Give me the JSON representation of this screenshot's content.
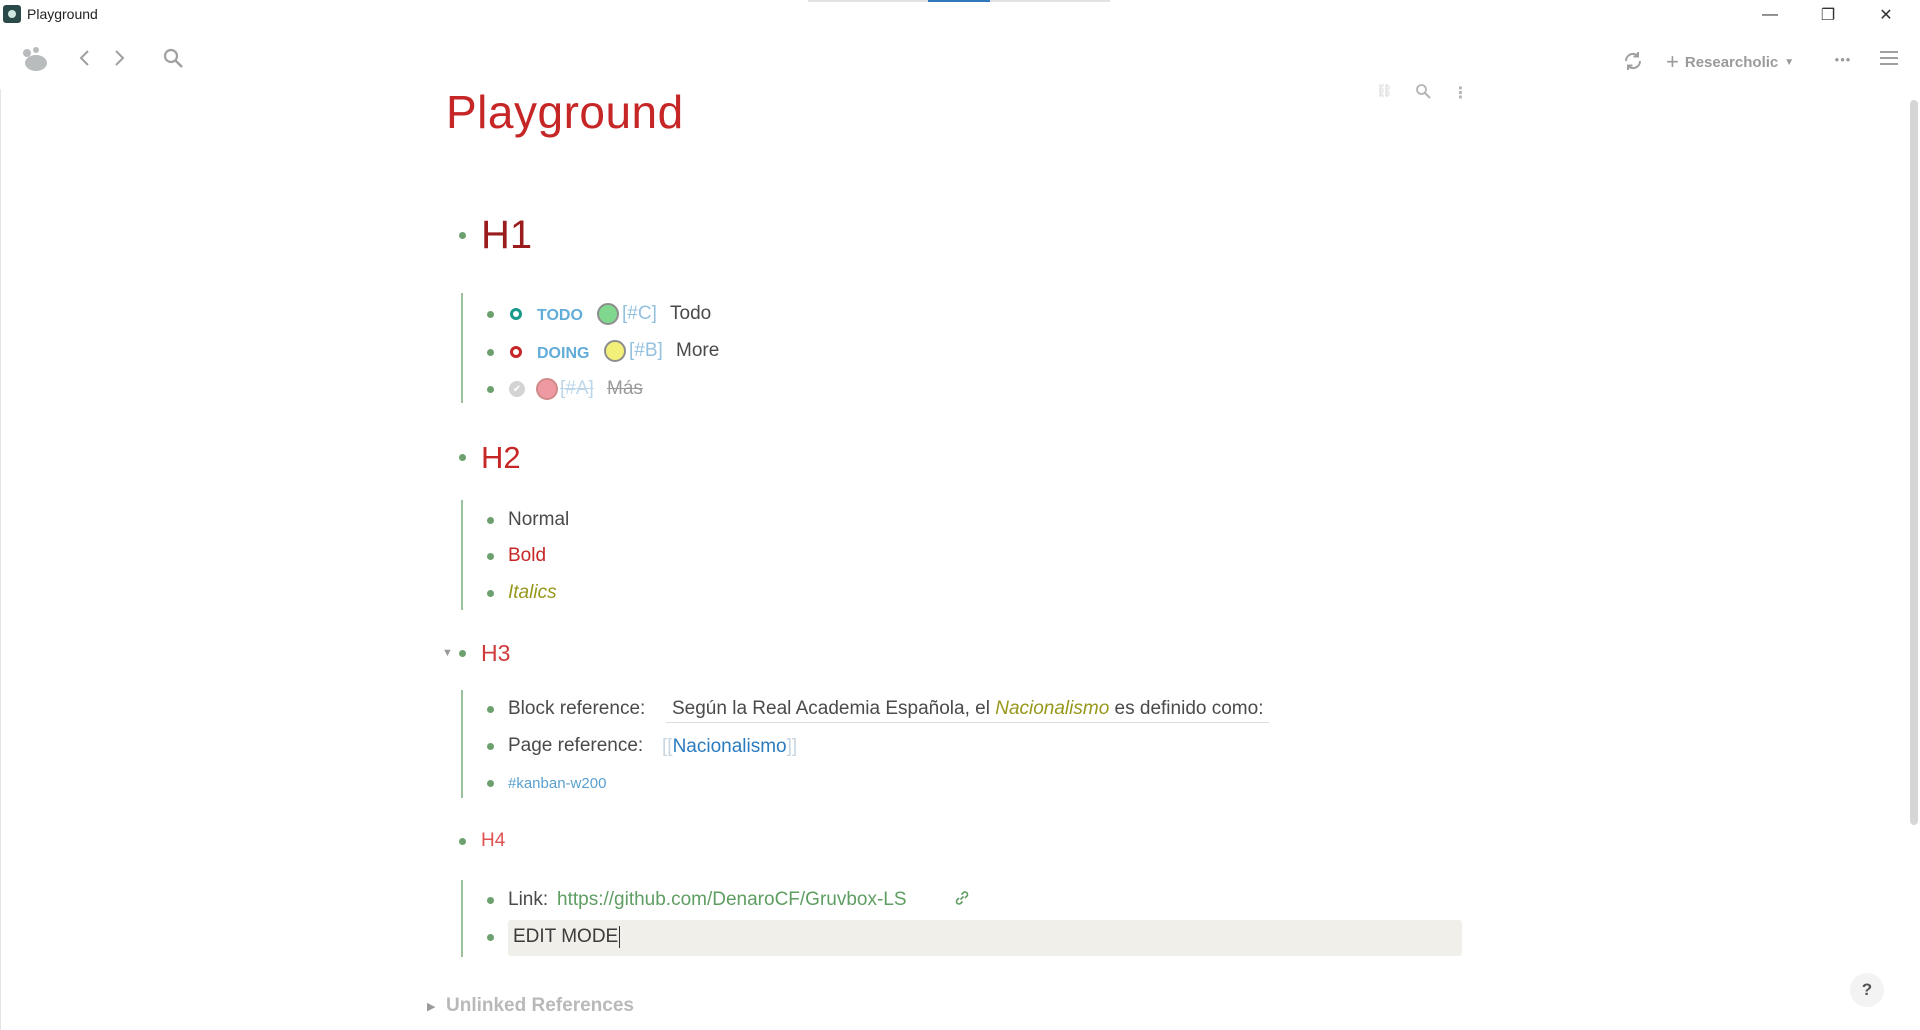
{
  "window": {
    "title": "Playground",
    "minimize": "—",
    "restore": "❐",
    "close": "✕"
  },
  "toolbar": {
    "graph_name": "Researcholic",
    "more": "•••"
  },
  "page": {
    "title": "Playground"
  },
  "h1": {
    "text": "H1",
    "todo_marker": "TODO",
    "todo_priority": "[#C]",
    "todo_text": "Todo",
    "doing_marker": "DOING",
    "doing_priority": "[#B]",
    "doing_text": "More",
    "done_priority": "[#A]",
    "done_text": "Más"
  },
  "h2": {
    "text": "H2",
    "items": [
      "Normal",
      "Bold",
      "Italics"
    ]
  },
  "h3": {
    "text": "H3",
    "block_ref_label": "Block reference:",
    "block_ref_pre": "Según la Real Academia Española, el",
    "block_ref_italic": "Nacionalismo",
    "block_ref_post": "es definido como:",
    "page_ref_label": "Page reference:",
    "page_ref_open": "[[",
    "page_ref_text": "Nacionalismo",
    "page_ref_close": "]]",
    "tag": "#kanban-w200"
  },
  "h4": {
    "text": "H4",
    "link_label": "Link:",
    "link_url": "https://github.com/DenaroCF/Gruvbox-LS",
    "edit_text": "EDIT MODE"
  },
  "footer": {
    "unlinked_references": "Unlinked References",
    "help": "?"
  },
  "colors": {
    "heading_red": "#c62626",
    "bullet_green": "#6ca06e",
    "todo_teal": "#1a9a8a",
    "doing_red": "#c62626",
    "priority_C": "#7fd88e",
    "priority_B": "#f3f07a",
    "priority_A": "#ef9aa2",
    "link_green": "#5f9e62",
    "italic_olive": "#97981b",
    "page_ref_blue": "#2b7bbf"
  }
}
